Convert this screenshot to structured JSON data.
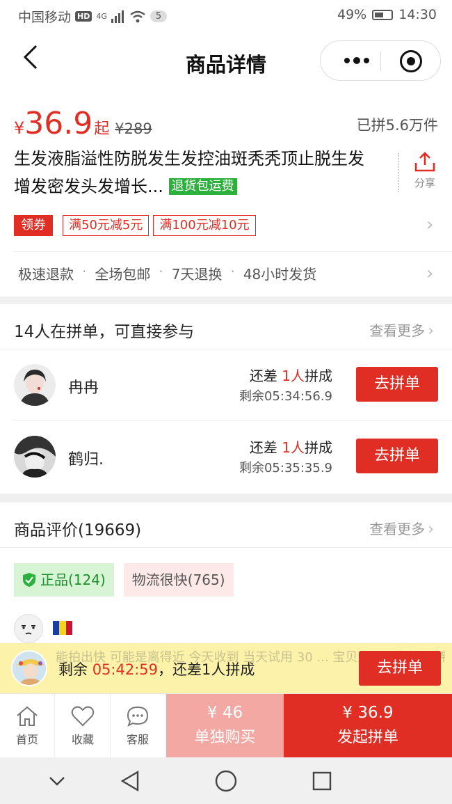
{
  "status_bar": {
    "carrier": "中国移动",
    "hd": "HD",
    "net": "4G",
    "notif_count": "5",
    "battery": "49%",
    "time": "14:30"
  },
  "nav": {
    "title": "商品详情",
    "back_icon": "back-arrow-icon",
    "more_icon": "more-dots-icon",
    "close_icon": "target-circle-icon"
  },
  "product": {
    "currency": "¥",
    "price": "36.9",
    "price_suffix": "起",
    "original_price": "¥289",
    "sold": "已拼5.6万件",
    "title": "生发液脂溢性防脱发生发控油斑秃秃顶止脱生发增发密发头发增长...",
    "refund_tag": "退货包运费",
    "share_label": "分享",
    "coupon_label": "领券",
    "coupons": [
      "满50元减5元",
      "满100元减10元"
    ],
    "services": [
      "极速退款",
      "全场包邮",
      "7天退换",
      "48小时发货"
    ]
  },
  "group_buy": {
    "header": "14人在拼单，可直接参与",
    "see_more": "查看更多",
    "rows": [
      {
        "name": "冉冉",
        "need_prefix": "还差",
        "need_count": "1人",
        "need_suffix": "拼成",
        "remaining": "剩余05:34:56.9",
        "button": "去拼单"
      },
      {
        "name": "鹤归.",
        "need_prefix": "还差",
        "need_count": "1人",
        "need_suffix": "拼成",
        "remaining": "剩余05:35:35.9",
        "button": "去拼单"
      }
    ]
  },
  "reviews": {
    "header": "商品评价(19669)",
    "see_more": "查看更多",
    "tags": [
      "正品(124)",
      "物流很快(765)"
    ],
    "behind_text": "能拍出快 可能是离得近 今天收到 当天试用 30 ... 宝贝用了没有效果 希望大家不要上当了 我"
  },
  "banner": {
    "remain_label": "剩余",
    "countdown": "05:42:59",
    "suffix": "，还差1人拼成",
    "button": "去拼单"
  },
  "action_bar": {
    "home": "首页",
    "favorite": "收藏",
    "service": "客服",
    "single_price": "¥ 46",
    "single_label": "单独购买",
    "group_price": "¥ 36.9",
    "group_label": "发起拼单"
  },
  "colors": {
    "accent": "#e02e24",
    "accent_light": "#f3a8a3",
    "green_tag": "#2bb13c",
    "banner_bg": "#fdf2a9"
  }
}
